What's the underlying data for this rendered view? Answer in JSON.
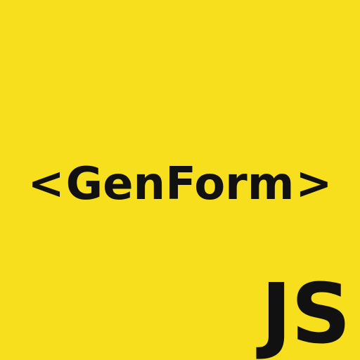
{
  "logo": {
    "left_bracket": "<",
    "name": "GenForm",
    "right_bracket": ">",
    "language_badge": "JS"
  },
  "colors": {
    "background": "#f7df1e",
    "text": "#111111"
  }
}
